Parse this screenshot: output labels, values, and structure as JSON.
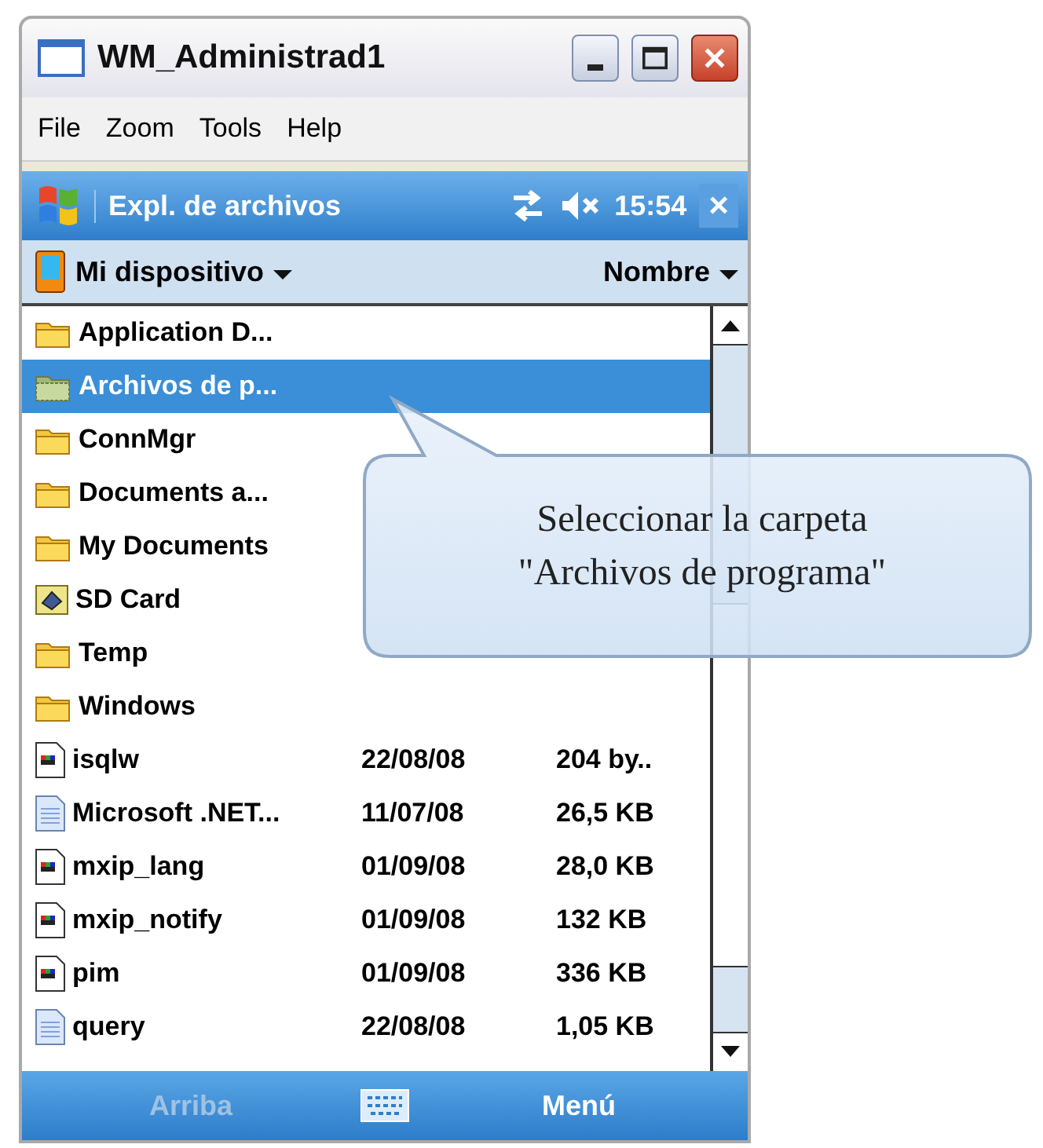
{
  "window": {
    "title": "WM_Administrad1"
  },
  "menu": [
    "File",
    "Zoom",
    "Tools",
    "Help"
  ],
  "nav_bar": {
    "title": "Expl. de archivos",
    "time": "15:54",
    "close": "×"
  },
  "header": {
    "location": "Mi dispositivo",
    "sort": "Nombre"
  },
  "files": [
    {
      "kind": "folder",
      "name": "Application D...",
      "selected": false
    },
    {
      "kind": "program-folder",
      "name": "Archivos de p...",
      "selected": true
    },
    {
      "kind": "folder",
      "name": "ConnMgr",
      "selected": false
    },
    {
      "kind": "folder",
      "name": "Documents a...",
      "selected": false
    },
    {
      "kind": "folder",
      "name": "My Documents",
      "selected": false
    },
    {
      "kind": "card",
      "name": "SD Card",
      "selected": false
    },
    {
      "kind": "folder",
      "name": "Temp",
      "selected": false
    },
    {
      "kind": "folder",
      "name": "Windows",
      "selected": false
    },
    {
      "kind": "program",
      "name": "isqlw",
      "date": "22/08/08",
      "size": "204 by..",
      "selected": false
    },
    {
      "kind": "document",
      "name": "Microsoft .NET...",
      "date": "11/07/08",
      "size": "26,5 KB",
      "selected": false
    },
    {
      "kind": "program",
      "name": "mxip_lang",
      "date": "01/09/08",
      "size": "28,0 KB",
      "selected": false
    },
    {
      "kind": "program",
      "name": "mxip_notify",
      "date": "01/09/08",
      "size": "132 KB",
      "selected": false
    },
    {
      "kind": "program",
      "name": "pim",
      "date": "01/09/08",
      "size": "336 KB",
      "selected": false
    },
    {
      "kind": "document",
      "name": "query",
      "date": "22/08/08",
      "size": "1,05 KB",
      "selected": false
    }
  ],
  "soft_keys": {
    "left": {
      "label": "Arriba",
      "disabled": true
    },
    "right": {
      "label": "Menú",
      "disabled": false
    }
  },
  "callout": {
    "lines": [
      "Seleccionar la carpeta",
      "\"Archivos de programa\""
    ]
  }
}
